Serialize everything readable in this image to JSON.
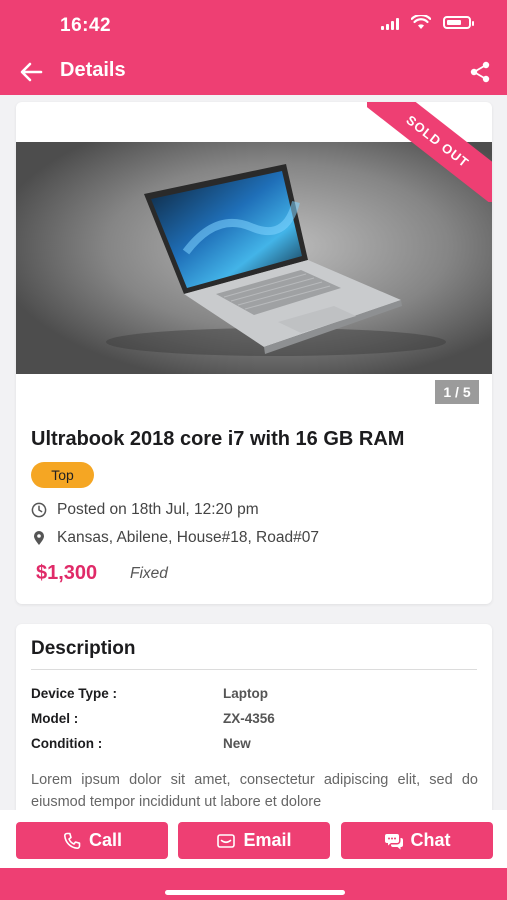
{
  "status_bar": {
    "time": "16:42"
  },
  "header": {
    "title": "Details"
  },
  "product": {
    "badge": "SOLD OUT",
    "image_counter": "1 / 5",
    "title": "Ultrabook 2018 core i7 with 16 GB RAM",
    "tag": "Top",
    "posted": "Posted on 18th Jul, 12:20 pm",
    "location": "Kansas, Abilene, House#18, Road#07",
    "price": "$1,300",
    "price_type": "Fixed"
  },
  "description": {
    "title": "Description",
    "specs": [
      {
        "label": "Device Type :",
        "value": "Laptop"
      },
      {
        "label": "Model :",
        "value": "ZX-4356"
      },
      {
        "label": "Condition :",
        "value": "New"
      }
    ],
    "body": "Lorem ipsum dolor sit amet, consectetur adipiscing elit, sed do eiusmod tempor incididunt ut labore et dolore"
  },
  "actions": {
    "call": "Call",
    "email": "Email",
    "chat": "Chat"
  },
  "colors": {
    "primary": "#ee3f73",
    "price": "#e02a68",
    "tag": "#f5a623"
  },
  "icons": [
    "back-arrow-icon",
    "share-icon",
    "clock-icon",
    "location-pin-icon",
    "phone-icon",
    "email-icon",
    "chat-icon"
  ]
}
